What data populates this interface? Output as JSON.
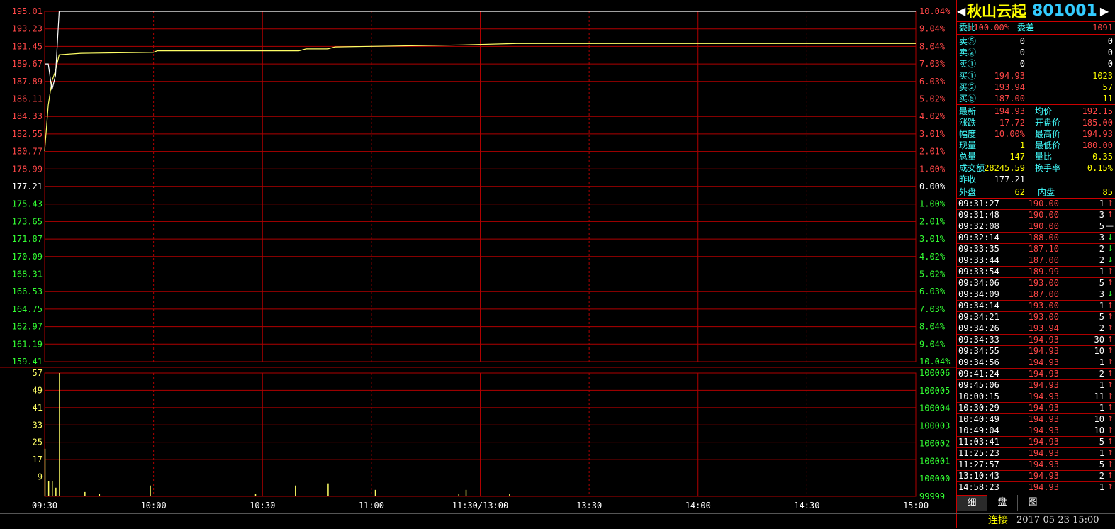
{
  "stock": {
    "name": "秋山云起",
    "code": "801001",
    "prev_close": "177.21"
  },
  "chart_data": {
    "type": "line",
    "price_axis_left": [
      "195.01",
      "193.23",
      "191.45",
      "189.67",
      "187.89",
      "186.11",
      "184.33",
      "182.55",
      "180.77",
      "178.99",
      "177.21",
      "175.43",
      "173.65",
      "171.87",
      "170.09",
      "168.31",
      "166.53",
      "164.75",
      "162.97",
      "161.19",
      "159.41"
    ],
    "pct_axis_right": [
      "10.04%",
      "9.04%",
      "8.04%",
      "7.03%",
      "6.03%",
      "5.02%",
      "4.02%",
      "3.01%",
      "2.01%",
      "1.00%",
      "0.00%",
      "1.00%",
      "2.01%",
      "3.01%",
      "4.02%",
      "5.02%",
      "6.03%",
      "7.03%",
      "8.04%",
      "9.04%",
      "10.04%"
    ],
    "price_range": [
      159.41,
      195.01
    ],
    "volume_axis_left": [
      "57",
      "49",
      "41",
      "33",
      "25",
      "17",
      "9"
    ],
    "volume_axis_right": [
      "100006",
      "100005",
      "100004",
      "100003",
      "100002",
      "100001",
      "100000",
      "99999"
    ],
    "volume_max": 57,
    "volume_baseline": 9,
    "time_labels": [
      "09:30",
      "10:00",
      "10:30",
      "11:00",
      "11:30/13:00",
      "13:30",
      "14:00",
      "14:30",
      "15:00"
    ],
    "total_minutes": 240,
    "grid": true,
    "price_series": [
      [
        0,
        189.67
      ],
      [
        1,
        189.67
      ],
      [
        2,
        187.0
      ],
      [
        3,
        188.5
      ],
      [
        4,
        195.01
      ],
      [
        240,
        195.01
      ]
    ],
    "avg_price_series": [
      [
        0,
        180.8
      ],
      [
        1,
        185.5
      ],
      [
        2,
        187.9
      ],
      [
        3,
        189.0
      ],
      [
        4,
        190.6
      ],
      [
        10,
        190.75
      ],
      [
        30,
        190.85
      ],
      [
        31,
        191.0
      ],
      [
        70,
        191.0
      ],
      [
        72,
        191.2
      ],
      [
        78,
        191.2
      ],
      [
        80,
        191.4
      ],
      [
        115,
        191.6
      ],
      [
        130,
        191.75
      ],
      [
        240,
        191.75
      ]
    ],
    "volume_bars": [
      [
        0,
        22
      ],
      [
        1,
        7
      ],
      [
        2,
        7
      ],
      [
        3,
        4
      ],
      [
        4,
        57
      ],
      [
        11,
        2
      ],
      [
        15,
        1
      ],
      [
        29,
        5
      ],
      [
        58,
        1
      ],
      [
        69,
        5
      ],
      [
        78,
        6
      ],
      [
        91,
        3
      ],
      [
        114,
        1
      ],
      [
        116,
        3
      ],
      [
        128,
        1
      ]
    ]
  },
  "quote": {
    "weibi_label": "委比",
    "weibi_value": "+100.00%",
    "weicha_label": "委差",
    "weicha_value": "1091",
    "sell": [
      {
        "label": "卖⑤",
        "price": "0",
        "vol": "0"
      },
      {
        "label": "卖②",
        "price": "0",
        "vol": "0"
      },
      {
        "label": "卖①",
        "price": "0",
        "vol": "0"
      }
    ],
    "buy": [
      {
        "label": "买①",
        "price": "194.93",
        "vol": "1023"
      },
      {
        "label": "买②",
        "price": "193.94",
        "vol": "57"
      },
      {
        "label": "买⑤",
        "price": "187.00",
        "vol": "11"
      }
    ],
    "stats": [
      {
        "l1": "最新",
        "v1": "194.93",
        "c1": "up",
        "l2": "均价",
        "v2": "192.15",
        "c2": "up"
      },
      {
        "l1": "涨跌",
        "v1": "17.72",
        "c1": "up",
        "l2": "开盘价",
        "v2": "185.00",
        "c2": "up"
      },
      {
        "l1": "幅度",
        "v1": "10.00%",
        "c1": "up",
        "l2": "最高价",
        "v2": "194.93",
        "c2": "up"
      },
      {
        "l1": "现量",
        "v1": "1",
        "c1": "yel",
        "l2": "最低价",
        "v2": "180.00",
        "c2": "up"
      },
      {
        "l1": "总量",
        "v1": "147",
        "c1": "yel",
        "l2": "量比",
        "v2": "0.35",
        "c2": "yel"
      },
      {
        "l1": "成交额",
        "v1": "28245.59",
        "c1": "yel",
        "l2": "换手率",
        "v2": "0.15%",
        "c2": "yel"
      }
    ],
    "prevclose_label": "昨收",
    "outer_label": "外盘",
    "outer_value": "62",
    "inner_label": "内盘",
    "inner_value": "85"
  },
  "ticks": [
    {
      "time": "09:31:27",
      "price": "190.00",
      "vol": "1",
      "dir": "↑",
      "c": "up"
    },
    {
      "time": "09:31:48",
      "price": "190.00",
      "vol": "3",
      "dir": "↑",
      "c": "up"
    },
    {
      "time": "09:32:08",
      "price": "190.00",
      "vol": "5",
      "dir": "—",
      "c": "wht"
    },
    {
      "time": "09:32:14",
      "price": "188.00",
      "vol": "3",
      "dir": "↓",
      "c": "dn"
    },
    {
      "time": "09:33:35",
      "price": "187.10",
      "vol": "2",
      "dir": "↓",
      "c": "dn"
    },
    {
      "time": "09:33:44",
      "price": "187.00",
      "vol": "2",
      "dir": "↓",
      "c": "dn"
    },
    {
      "time": "09:33:54",
      "price": "189.99",
      "vol": "1",
      "dir": "↑",
      "c": "up"
    },
    {
      "time": "09:34:06",
      "price": "193.00",
      "vol": "5",
      "dir": "↑",
      "c": "up"
    },
    {
      "time": "09:34:09",
      "price": "187.00",
      "vol": "3",
      "dir": "↓",
      "c": "dn"
    },
    {
      "time": "09:34:14",
      "price": "193.00",
      "vol": "1",
      "dir": "↑",
      "c": "up"
    },
    {
      "time": "09:34:21",
      "price": "193.00",
      "vol": "5",
      "dir": "↑",
      "c": "up"
    },
    {
      "time": "09:34:26",
      "price": "193.94",
      "vol": "2",
      "dir": "↑",
      "c": "up"
    },
    {
      "time": "09:34:33",
      "price": "194.93",
      "vol": "30",
      "dir": "↑",
      "c": "up"
    },
    {
      "time": "09:34:55",
      "price": "194.93",
      "vol": "10",
      "dir": "↑",
      "c": "up"
    },
    {
      "time": "09:34:56",
      "price": "194.93",
      "vol": "1",
      "dir": "↑",
      "c": "up"
    },
    {
      "time": "09:41:24",
      "price": "194.93",
      "vol": "2",
      "dir": "↑",
      "c": "up"
    },
    {
      "time": "09:45:06",
      "price": "194.93",
      "vol": "1",
      "dir": "↑",
      "c": "up"
    },
    {
      "time": "10:00:15",
      "price": "194.93",
      "vol": "11",
      "dir": "↑",
      "c": "up"
    },
    {
      "time": "10:30:29",
      "price": "194.93",
      "vol": "1",
      "dir": "↑",
      "c": "up"
    },
    {
      "time": "10:40:49",
      "price": "194.93",
      "vol": "10",
      "dir": "↑",
      "c": "up"
    },
    {
      "time": "10:49:04",
      "price": "194.93",
      "vol": "10",
      "dir": "↑",
      "c": "up"
    },
    {
      "time": "11:03:41",
      "price": "194.93",
      "vol": "5",
      "dir": "↑",
      "c": "up"
    },
    {
      "time": "11:25:23",
      "price": "194.93",
      "vol": "1",
      "dir": "↑",
      "c": "up"
    },
    {
      "time": "11:27:57",
      "price": "194.93",
      "vol": "5",
      "dir": "↑",
      "c": "up"
    },
    {
      "time": "13:10:43",
      "price": "194.93",
      "vol": "2",
      "dir": "↑",
      "c": "up"
    },
    {
      "time": "14:58:23",
      "price": "194.93",
      "vol": "1",
      "dir": "↑",
      "c": "up"
    }
  ],
  "tabs": [
    "细",
    "盘",
    "图"
  ],
  "status": {
    "connection": "连接",
    "datetime": "2017-05-23 15:00"
  },
  "colors": {
    "price_line": "#ffffff",
    "avg_line": "#ffff66",
    "grid": "#b00000",
    "up": "#ff4747",
    "down": "#33ff33",
    "volume": "#ffff66",
    "label": "#44ffff"
  }
}
